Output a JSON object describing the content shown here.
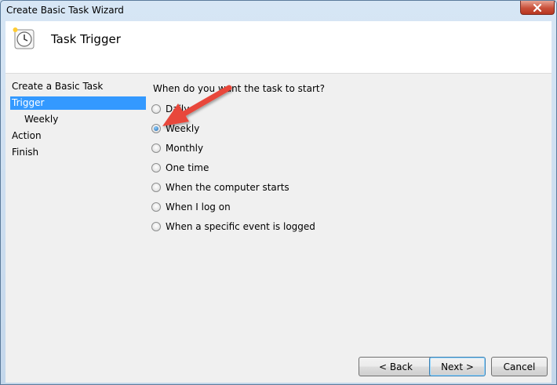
{
  "window": {
    "title": "Create Basic Task Wizard"
  },
  "header": {
    "title": "Task Trigger",
    "icon": "clock-icon"
  },
  "nav": {
    "items": [
      {
        "label": "Create a Basic Task",
        "selected": false,
        "level": 0
      },
      {
        "label": "Trigger",
        "selected": true,
        "level": 0
      },
      {
        "label": "Weekly",
        "selected": false,
        "level": 1
      },
      {
        "label": "Action",
        "selected": false,
        "level": 0
      },
      {
        "label": "Finish",
        "selected": false,
        "level": 0
      }
    ]
  },
  "main": {
    "question": "When do you want the task to start?",
    "options": [
      {
        "label": "Daily",
        "checked": false
      },
      {
        "label": "Weekly",
        "checked": true
      },
      {
        "label": "Monthly",
        "checked": false
      },
      {
        "label": "One time",
        "checked": false
      },
      {
        "label": "When the computer starts",
        "checked": false
      },
      {
        "label": "When I log on",
        "checked": false
      },
      {
        "label": "When a specific event is logged",
        "checked": false
      }
    ]
  },
  "footer": {
    "back_label": "< Back",
    "next_label": "Next >",
    "cancel_label": "Cancel"
  },
  "colors": {
    "selection": "#3399ff",
    "annotation_arrow": "#e8463a"
  }
}
